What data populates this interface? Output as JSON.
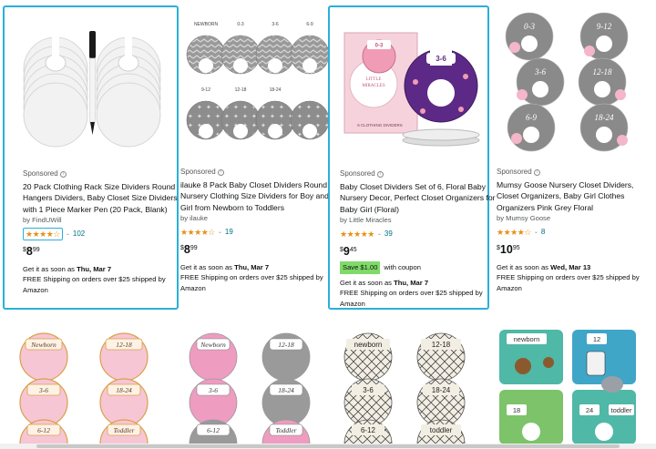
{
  "products": [
    {
      "sponsored": "Sponsored",
      "title": "20 Pack Clothing Rack Size Dividers Round Hangers Dividers, Baby Closet Size Dividers with 1 Piece Marker Pen (20 Pack, Blank)",
      "brand": "by FindUWill",
      "rating": "4.5 out of 5 stars",
      "review_count": "102",
      "price_currency": "$",
      "price_whole": "8",
      "price_fraction": "99",
      "delivery_prefix": "Get it as soon as ",
      "delivery_date": "Thu, Mar 7",
      "shipping": "FREE Shipping on orders over $25 shipped by Amazon"
    },
    {
      "sponsored": "Sponsored",
      "title": "ilauke 8 Pack Baby Closet Dividers Round Nursery Clothing Size Dividers for Boy and Girl from Newborn to Toddlers",
      "brand": "by ilauke",
      "rating": "4.5 out of 5 stars",
      "review_count": "19",
      "price_currency": "$",
      "price_whole": "8",
      "price_fraction": "99",
      "delivery_prefix": "Get it as soon as ",
      "delivery_date": "Thu, Mar 7",
      "shipping": "FREE Shipping on orders over $25 shipped by Amazon"
    },
    {
      "sponsored": "Sponsored",
      "title": "Baby Closet Dividers Set of 6, Floral Baby Nursery Decor, Perfect Closet Organizers for Baby Girl (Floral)",
      "brand": "by Little Miracles",
      "rating": "5 out of 5 stars",
      "review_count": "39",
      "price_currency": "$",
      "price_whole": "9",
      "price_fraction": "45",
      "coupon_badge": "Save $1.00",
      "coupon_text": "with coupon",
      "delivery_prefix": "Get it as soon as ",
      "delivery_date": "Thu, Mar 7",
      "shipping": "FREE Shipping on orders over $25 shipped by Amazon"
    },
    {
      "sponsored": "Sponsored",
      "title": "Mumsy Goose Nursery Closet Dividers, Closet Organizers, Baby Girl Clothes Organizers Pink Grey Floral",
      "brand": "by Mumsy Goose",
      "rating": "4.5 out of 5 stars",
      "review_count": "8",
      "price_currency": "$",
      "price_whole": "10",
      "price_fraction": "95",
      "delivery_prefix": "Get it as soon as ",
      "delivery_date": "Wed, Mar 13",
      "shipping": "FREE Shipping on orders over $25 shipped by Amazon"
    }
  ],
  "stars_full": "★★★★★",
  "stars_half": "★★★★☆",
  "chevron": "⌄",
  "info_glyph": "i",
  "image_labels": {
    "sizes_gray": [
      "0-3",
      "3-6",
      "6-9",
      "9-12",
      "12-18",
      "18-24",
      "NEWBORN"
    ],
    "little_miracles": [
      "0-3",
      "3-6",
      "LITTLE MIRACLES",
      "6 CLOTHING DIVIDERS"
    ],
    "mumsy": [
      "0-3",
      "3-6",
      "6-9",
      "9-12",
      "12-18",
      "18-24"
    ],
    "pink_floral": [
      "Newborn",
      "12-18",
      "3-6",
      "18-24",
      "6-12",
      "Toddler"
    ],
    "pink_gray": [
      "Newborn",
      "12-18",
      "3-6",
      "18-24",
      "6-12",
      "Toddler"
    ],
    "tribal": [
      "newborn",
      "12-18",
      "3-6",
      "18-24",
      "6-12",
      "toddler"
    ],
    "animals": [
      "newborn",
      "12",
      "18",
      "24",
      "toddler"
    ]
  },
  "colors": {
    "focus_border": "#2ab0d8",
    "link": "#007185",
    "star": "#e69016",
    "coupon": "#7fda69"
  }
}
